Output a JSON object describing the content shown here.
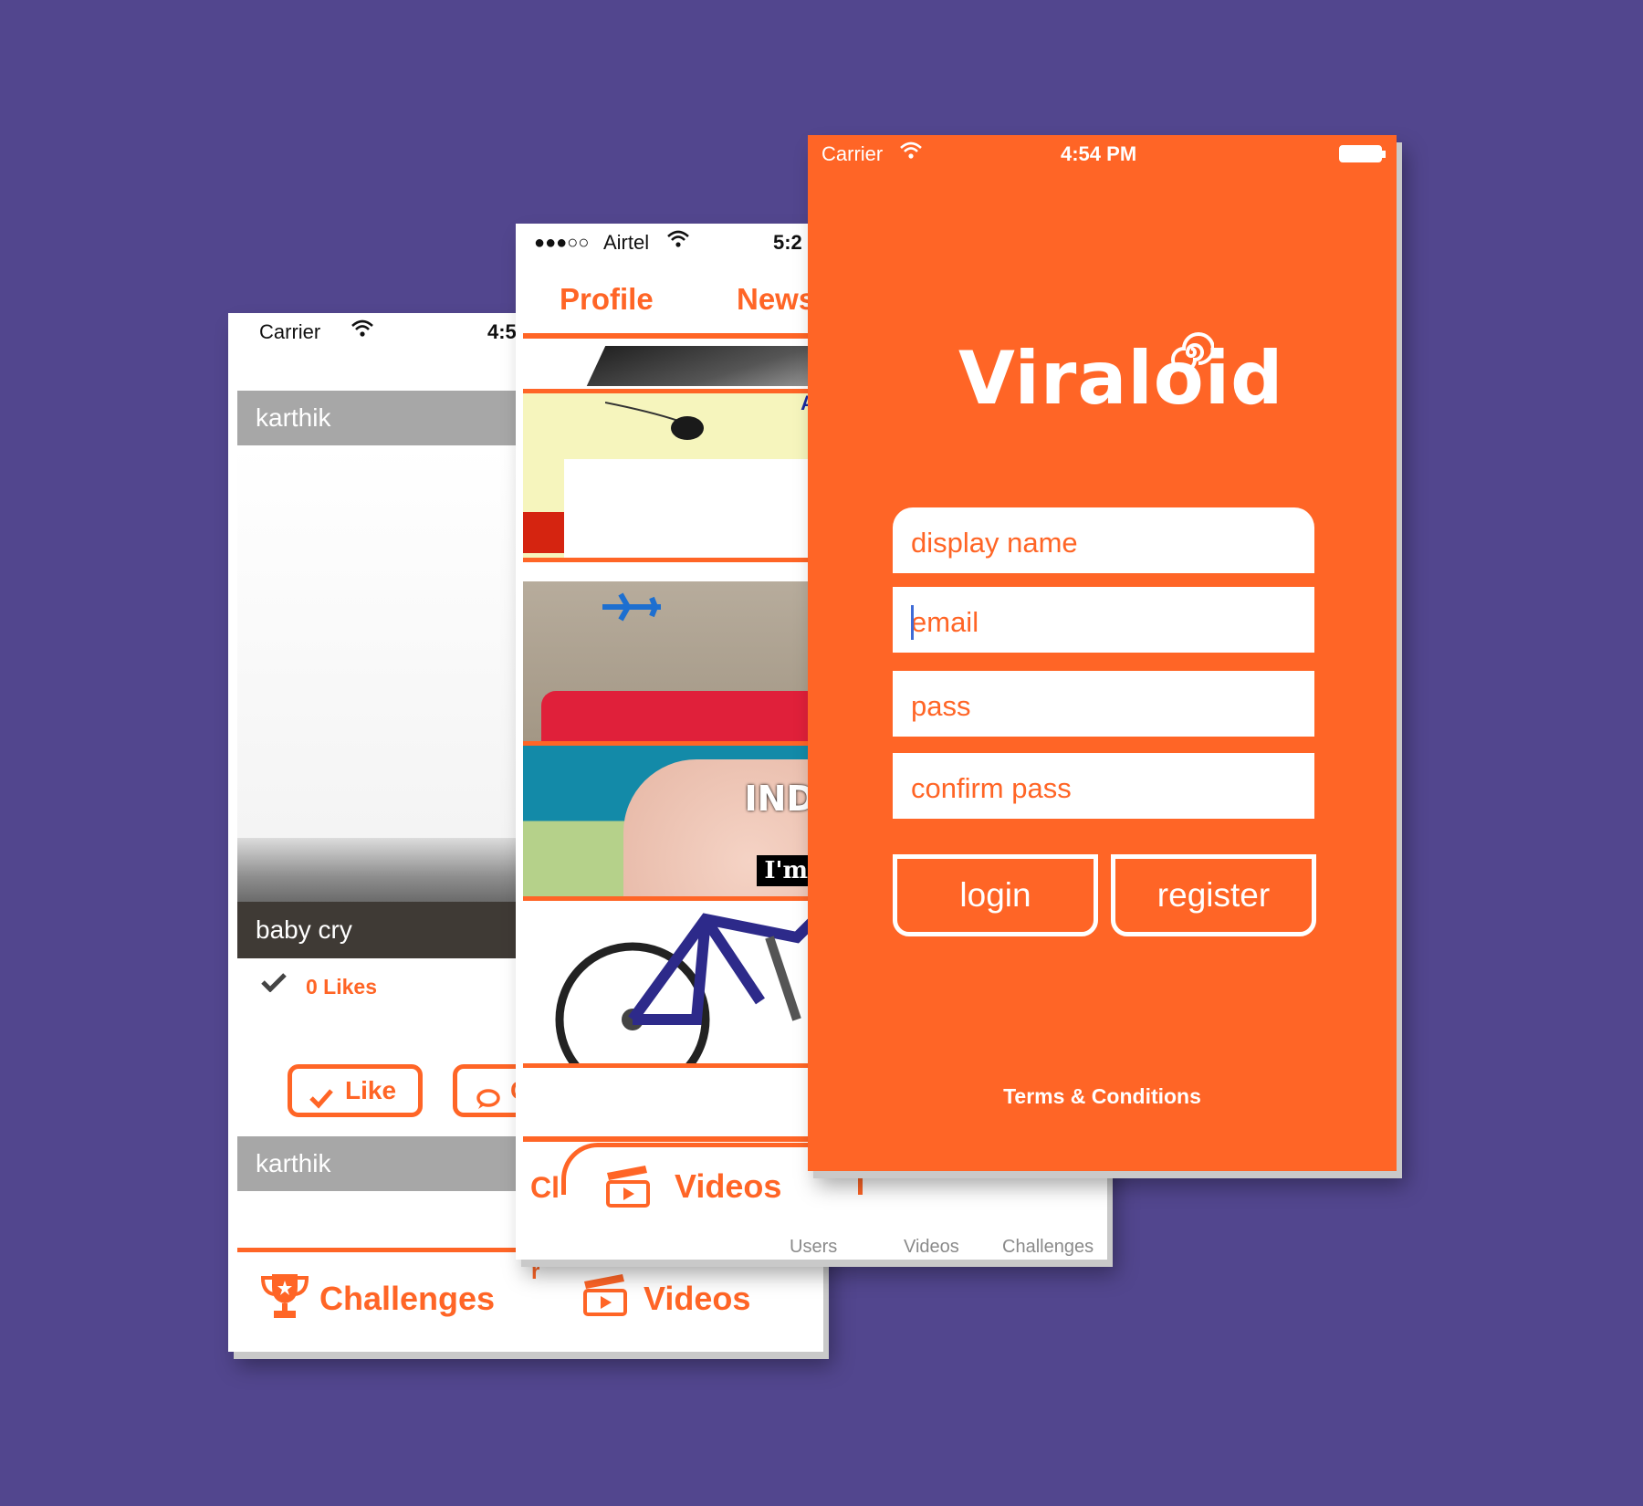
{
  "feed_screen": {
    "status": {
      "carrier": "Carrier",
      "time": "4:5"
    },
    "posts": [
      {
        "user": "karthik",
        "caption": "baby cry",
        "likes": "0 Likes"
      },
      {
        "user": "karthik"
      }
    ],
    "like_button": "Like",
    "comment_button": "C",
    "tabs": {
      "challenges": "Challenges",
      "videos": "Videos",
      "partial": "r"
    }
  },
  "news_screen": {
    "status": {
      "signal": "●●●○○",
      "carrier": "Airtel",
      "time": "5:2"
    },
    "top_tabs": {
      "profile": "Profile",
      "news": "News"
    },
    "thumb_text": {
      "laptop_banner": "A",
      "meme_top": "IND",
      "meme_bottom": "I'm"
    },
    "bottom": {
      "partial_tab": "Cl",
      "videos": "Videos"
    },
    "tab_labels": [
      "Users",
      "Videos",
      "Challenges"
    ]
  },
  "register_screen": {
    "status": {
      "carrier": "Carrier",
      "time": "4:54 PM"
    },
    "logo": "Viraloid",
    "fields": {
      "display_name": "display name",
      "email": "email",
      "pass": "pass",
      "confirm_pass": "confirm pass"
    },
    "buttons": {
      "login": "login",
      "register": "register"
    },
    "terms": "Terms & Conditions"
  },
  "colors": {
    "background": "#52468e",
    "accent": "#ff6526",
    "white": "#ffffff"
  }
}
